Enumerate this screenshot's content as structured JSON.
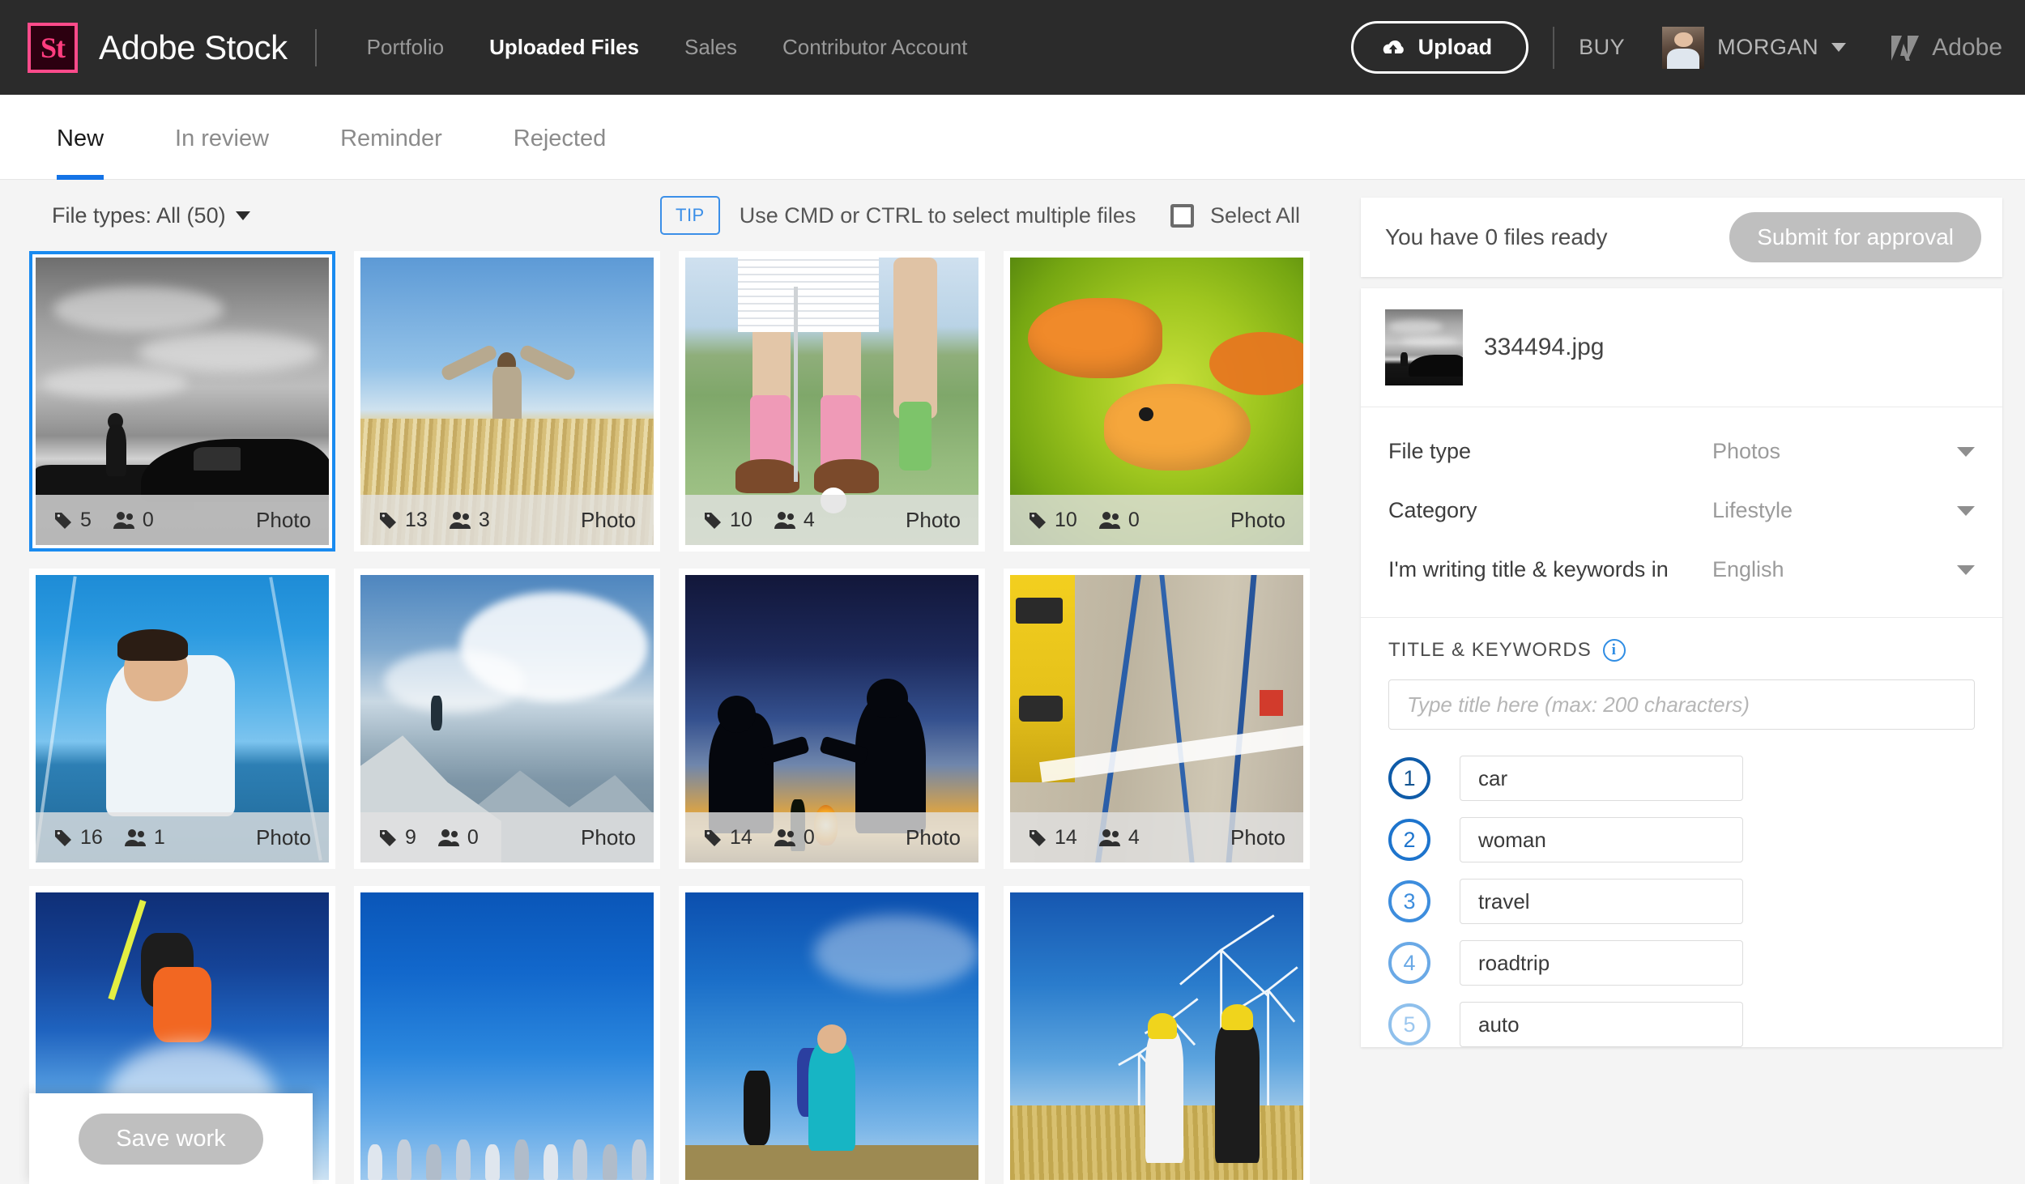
{
  "header": {
    "logo_text": "St",
    "brand": "Adobe Stock",
    "nav": [
      {
        "label": "Portfolio",
        "active": false
      },
      {
        "label": "Uploaded Files",
        "active": true
      },
      {
        "label": "Sales",
        "active": false
      },
      {
        "label": "Contributor Account",
        "active": false
      }
    ],
    "upload_label": "Upload",
    "buy_label": "BUY",
    "username": "MORGAN",
    "adobe_label": "Adobe"
  },
  "tabs": [
    {
      "label": "New",
      "active": true
    },
    {
      "label": "In review",
      "active": false
    },
    {
      "label": "Reminder",
      "active": false
    },
    {
      "label": "Rejected",
      "active": false
    }
  ],
  "toolbar": {
    "file_types_label": "File types: All (50)",
    "tip_badge": "TIP",
    "tip_text": "Use CMD or CTRL to select multiple files",
    "select_all_label": "Select All"
  },
  "grid": {
    "items": [
      {
        "scene": "bw-car",
        "tags": "5",
        "people": "0",
        "kind": "Photo",
        "selected": true
      },
      {
        "scene": "wheat",
        "tags": "13",
        "people": "3",
        "kind": "Photo",
        "selected": false
      },
      {
        "scene": "golf",
        "tags": "10",
        "people": "4",
        "kind": "Photo",
        "selected": false
      },
      {
        "scene": "fish",
        "tags": "10",
        "people": "0",
        "kind": "Photo",
        "selected": false
      },
      {
        "scene": "sail",
        "tags": "16",
        "people": "1",
        "kind": "Photo",
        "selected": false
      },
      {
        "scene": "mountain",
        "tags": "9",
        "people": "0",
        "kind": "Photo",
        "selected": false
      },
      {
        "scene": "dusk",
        "tags": "14",
        "people": "0",
        "kind": "Photo",
        "selected": false
      },
      {
        "scene": "wall",
        "tags": "14",
        "people": "4",
        "kind": "Photo",
        "selected": false
      },
      {
        "scene": "ski",
        "tags": "",
        "people": "",
        "kind": "",
        "selected": false
      },
      {
        "scene": "skychain",
        "tags": "",
        "people": "",
        "kind": "",
        "selected": false
      },
      {
        "scene": "cyclist",
        "tags": "",
        "people": "",
        "kind": "",
        "selected": false
      },
      {
        "scene": "windfarm",
        "tags": "",
        "people": "",
        "kind": "",
        "selected": false
      }
    ]
  },
  "save_panel": {
    "save_label": "Save work"
  },
  "right_panel": {
    "ready_text": "You have 0 files ready",
    "submit_label": "Submit for approval",
    "file_name": "334494.jpg",
    "fields": [
      {
        "label": "File type",
        "value": "Photos"
      },
      {
        "label": "Category",
        "value": "Lifestyle"
      },
      {
        "label": "I'm writing title & keywords in",
        "value": "English"
      }
    ],
    "title_keywords_heading": "TITLE & KEYWORDS",
    "info_icon_char": "i",
    "title_placeholder": "Type title here (max: 200 characters)",
    "keywords": [
      {
        "num": "1",
        "value": "car"
      },
      {
        "num": "2",
        "value": "woman"
      },
      {
        "num": "3",
        "value": "travel"
      },
      {
        "num": "4",
        "value": "roadtrip"
      },
      {
        "num": "5",
        "value": "auto"
      }
    ]
  },
  "colors": {
    "accent_blue": "#1473e6",
    "selection_blue": "#1a8bf0",
    "brand_pink": "#ff3d7f",
    "header_dark": "#2b2b2b",
    "disabled_gray": "#bfbfbf"
  }
}
